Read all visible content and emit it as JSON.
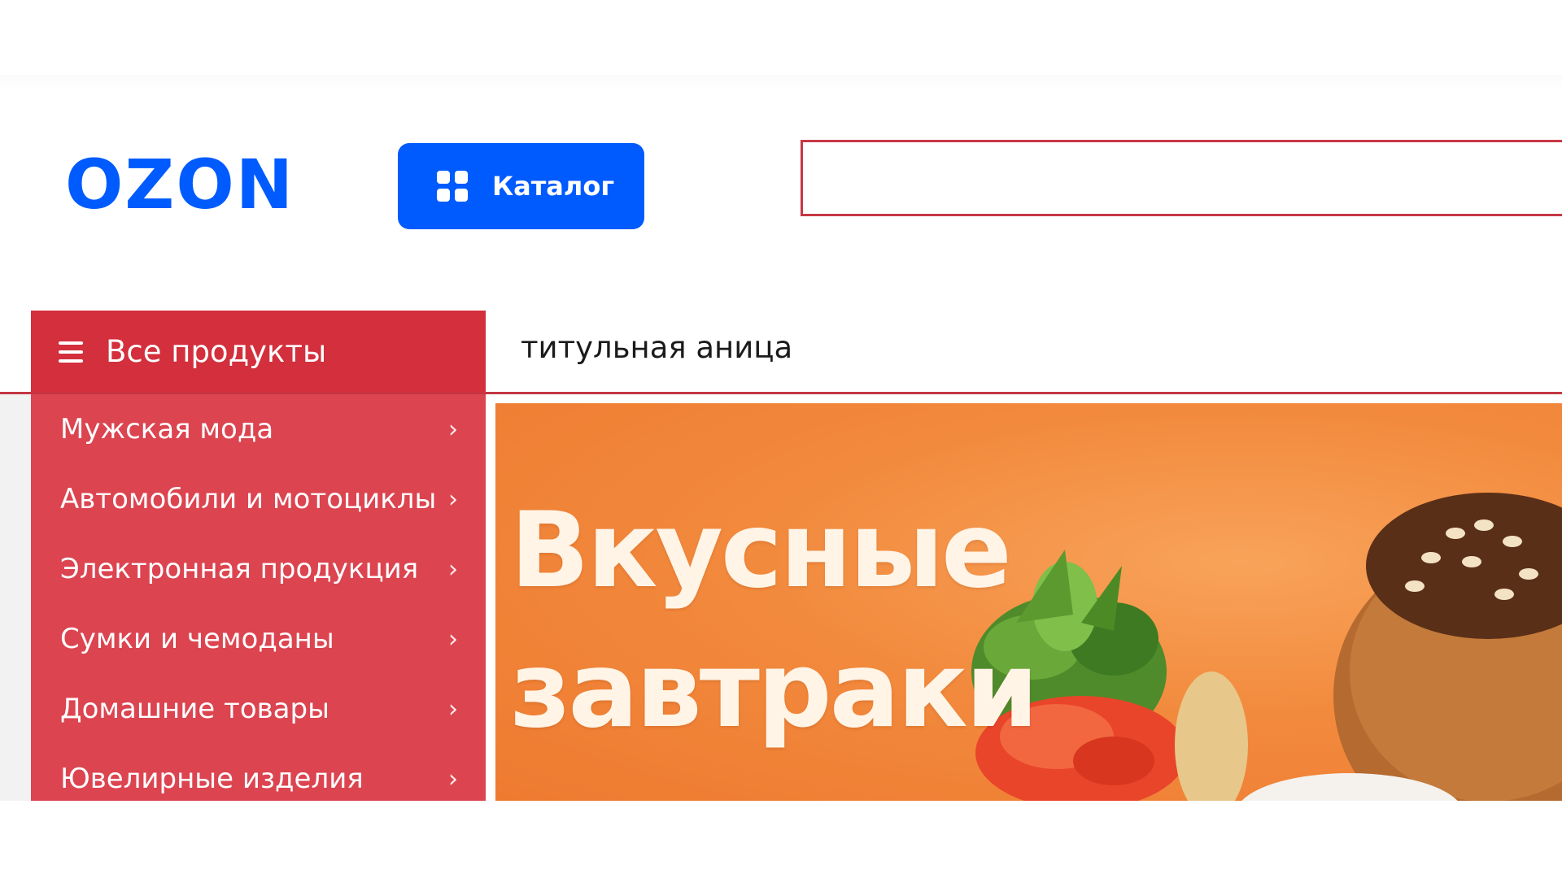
{
  "header": {
    "logo_text": "OZON",
    "catalog_label": "Каталог",
    "search": {
      "value": "",
      "placeholder": ""
    }
  },
  "nav": {
    "all_products_label": "Все продукты",
    "home_link": "титульная аница"
  },
  "sidebar": {
    "items": [
      {
        "label": "Мужская мода",
        "chevron": "›"
      },
      {
        "label": "Автомобили и мотоциклы",
        "chevron": "›"
      },
      {
        "label": "Электронная продукция",
        "chevron": "›"
      },
      {
        "label": "Сумки и чемоданы",
        "chevron": "›"
      },
      {
        "label": "Домашние товары",
        "chevron": "›"
      },
      {
        "label": "Ювелирные изделия",
        "chevron": "›"
      }
    ]
  },
  "banner": {
    "line1": "Вкусные",
    "line2": "завтраки"
  },
  "colors": {
    "brand_blue": "#005bff",
    "accent_red": "#d32f3c",
    "sidebar_red": "#dc4450",
    "banner_orange": "#f28a3d"
  },
  "icons": {
    "catalog": "grid-icon",
    "menu": "hamburger-icon",
    "submenu": "chevron-right-icon"
  }
}
